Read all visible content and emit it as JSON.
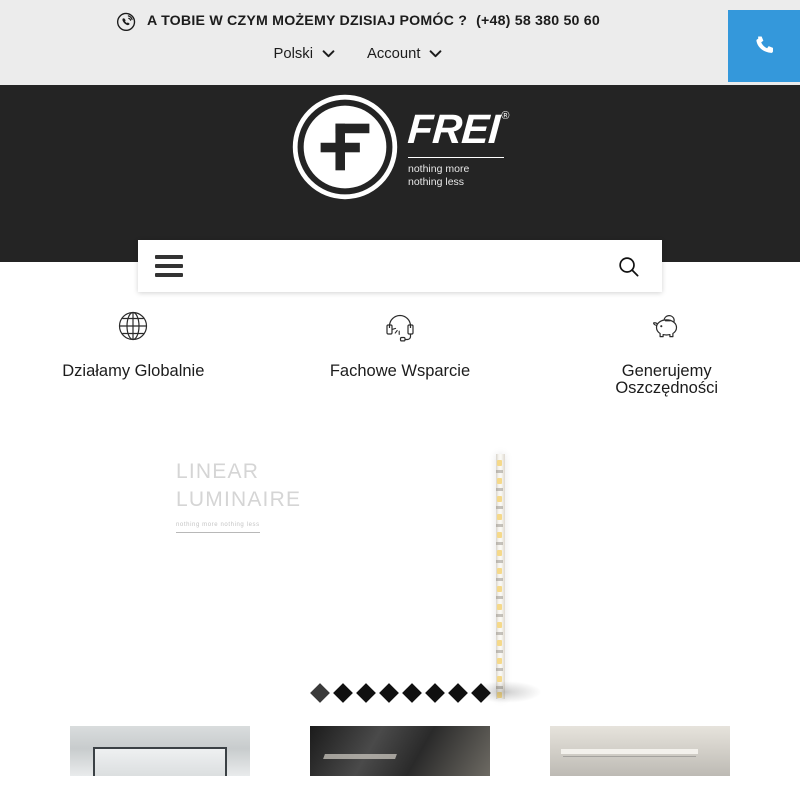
{
  "topbar": {
    "phone_icon": "phone-circle-icon",
    "contact_message": "A TOBIE W CZYM MOŻEMY DZISIAJ POMÓC ?",
    "contact_number": "(+48) 58 380 50 60",
    "nav": [
      {
        "label": "Polski",
        "icon": "chevron-down-icon"
      },
      {
        "label": "Account",
        "icon": "chevron-down-icon"
      }
    ],
    "cta": {
      "icon": "phone-handset-icon",
      "color": "#3498db"
    },
    "background": "#ececec"
  },
  "header": {
    "background": "#242424",
    "logo": {
      "mark_icon": "frei-circle-f-logo-icon",
      "brand": "FREI",
      "registered": "®",
      "tagline_line1": "nothing more",
      "tagline_line2": "nothing less"
    }
  },
  "search": {
    "menu_icon": "hamburger-menu-icon",
    "search_icon": "search-icon",
    "placeholder": ""
  },
  "features": [
    {
      "icon": "globe-icon",
      "label": "Działamy Globalnie"
    },
    {
      "icon": "headset-icon",
      "label": "Fachowe Wsparcie"
    },
    {
      "icon": "piggy-bank-icon",
      "label": "Generujemy\nOszczędności"
    }
  ],
  "carousel": {
    "slide_title": "LINEAR\nLUMINAIRE",
    "slide_subtitle": "nothing more nothing less",
    "product_icon": "led-strip-product-image",
    "dots_total": 8,
    "active_dot": 1
  },
  "cards": [
    {
      "name": "card-cleanroom-interior"
    },
    {
      "name": "card-industrial-dark"
    },
    {
      "name": "card-linear-pendant"
    }
  ]
}
